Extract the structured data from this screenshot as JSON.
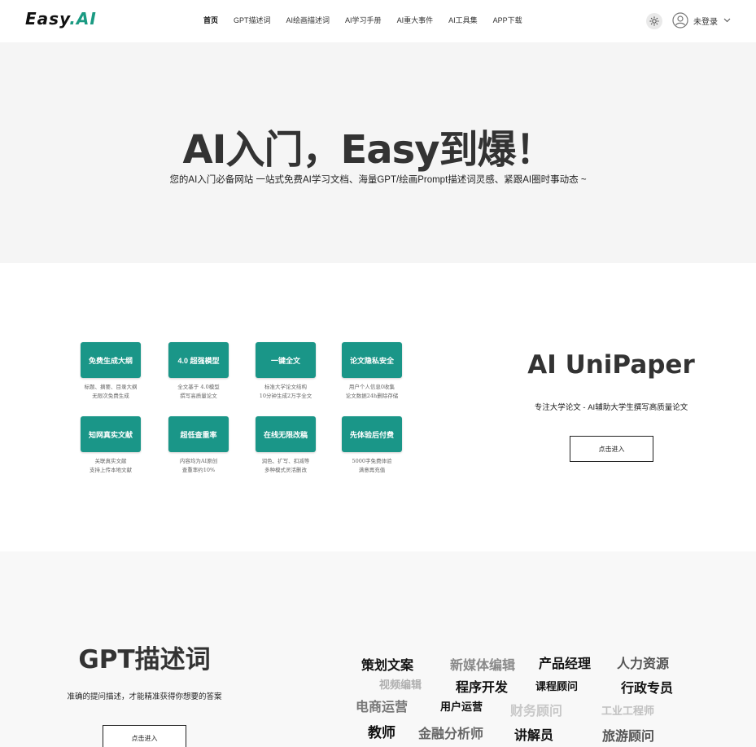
{
  "header": {
    "logo": {
      "text": "Easy",
      "dot": ".",
      "ai": "AI"
    },
    "nav": [
      "首页",
      "GPT描述词",
      "AI绘画描述词",
      "AI学习手册",
      "AI重大事件",
      "AI工具集",
      "APP下载"
    ],
    "user_label": "未登录"
  },
  "hero": {
    "title": "AI入门，Easy到爆！",
    "subtitle": "您的AI入门必备网站 一站式免费AI学习文档、海量GPT/绘画Prompt描述词灵感、紧跟AI圈时事动态 ~"
  },
  "unipaper": {
    "features": [
      {
        "label": "免费生成大纲",
        "desc1": "标题、摘要、目录大纲",
        "desc2": "无限次免费生成"
      },
      {
        "label": "4.0 超强模型",
        "desc1": "全文基于 4.0模型",
        "desc2": "撰写高质量论文"
      },
      {
        "label": "一键全文",
        "desc1": "标准大学论文结构",
        "desc2": "10分钟生成2万字全文"
      },
      {
        "label": "论文隐私安全",
        "desc1": "用户个人信息0收集",
        "desc2": "论文数据24h删除存储"
      },
      {
        "label": "知网真实文献",
        "desc1": "关联真实文献",
        "desc2": "支持上传本地文献"
      },
      {
        "label": "超低查重率",
        "desc1": "内容均为AI原创",
        "desc2": "查重率约10%"
      },
      {
        "label": "在线无限改稿",
        "desc1": "润色、扩写、扣减等",
        "desc2": "多种模式灵活删改"
      },
      {
        "label": "先体验后付费",
        "desc1": "5000字免费体验",
        "desc2": "满意再充值"
      }
    ],
    "title": "AI UniPaper",
    "subtitle": "专注大学论文 - AI辅助大学生撰写高质量论文",
    "button": "点击进入"
  },
  "gpt": {
    "title": "GPT描述词",
    "subtitle": "准确的提问描述，才能精准获得你想要的答案",
    "button": "点击进入",
    "tags": [
      {
        "text": "策划文案",
        "color": "#111111"
      },
      {
        "text": "新媒体编辑",
        "color": "#8a8a8a"
      },
      {
        "text": "产品经理",
        "color": "#111111"
      },
      {
        "text": "人力资源",
        "color": "#555555"
      },
      {
        "text": "视频编辑",
        "color": "#b0b0b0"
      },
      {
        "text": "程序开发",
        "color": "#111111"
      },
      {
        "text": "课程顾问",
        "color": "#111111"
      },
      {
        "text": "行政专员",
        "color": "#111111"
      },
      {
        "text": "电商运营",
        "color": "#777777"
      },
      {
        "text": "用户运营",
        "color": "#111111"
      },
      {
        "text": "财务顾问",
        "color": "#c8c8c8"
      },
      {
        "text": "工业工程师",
        "color": "#c0c0c0"
      },
      {
        "text": "教师",
        "color": "#111111"
      },
      {
        "text": "金融分析师",
        "color": "#666666"
      },
      {
        "text": "讲解员",
        "color": "#111111"
      },
      {
        "text": "旅游顾问",
        "color": "#555555"
      }
    ]
  },
  "colors": {
    "accent": "#1a9a82",
    "tile": "#1a9688"
  },
  "icons": {
    "theme": "sun-icon",
    "user": "user-avatar-icon",
    "chevron": "chevron-down-icon"
  }
}
